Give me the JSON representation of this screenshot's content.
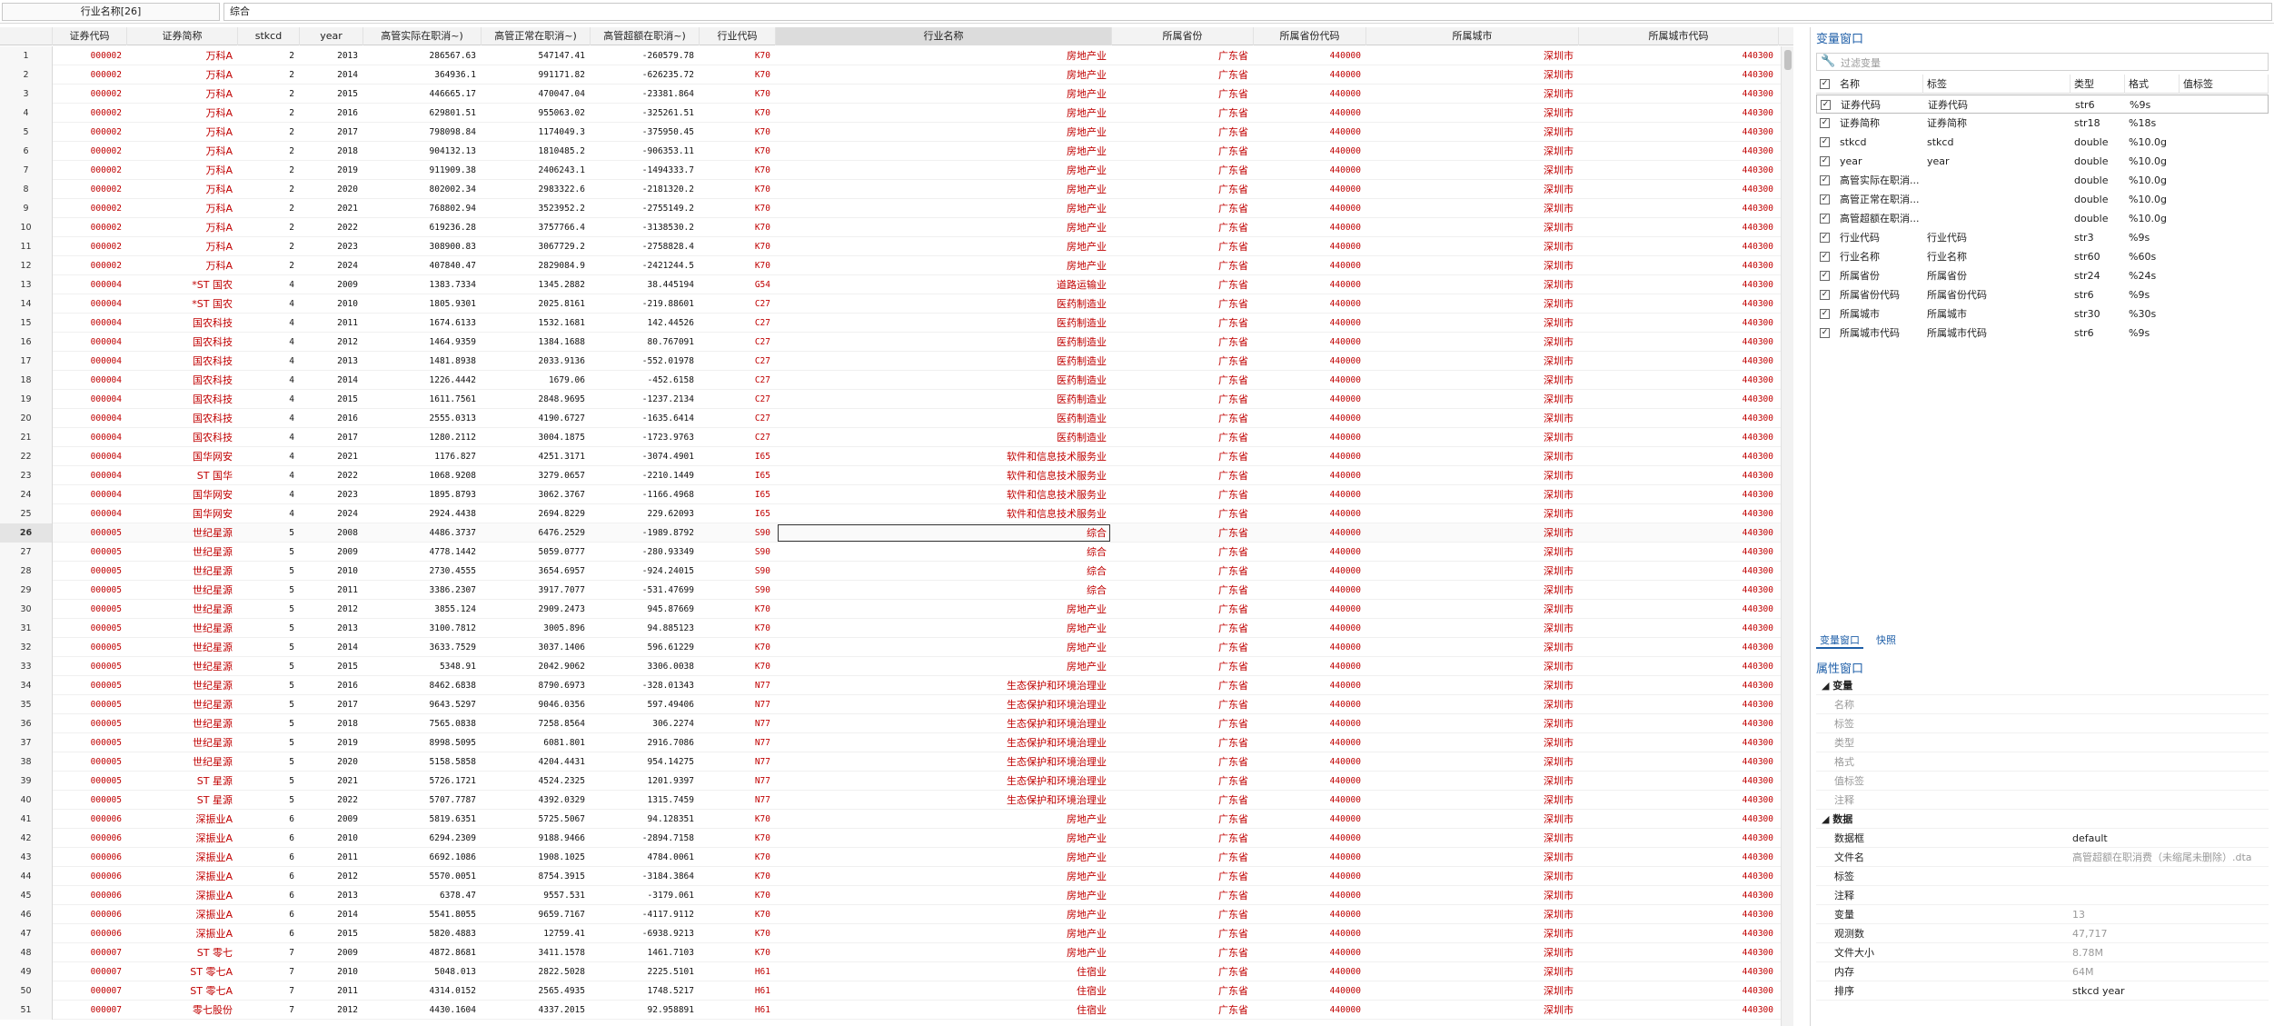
{
  "edit_bar": {
    "var_label": "行业名称[26]",
    "value": "综合"
  },
  "grid": {
    "columns": [
      "证券代码",
      "证券简称",
      "stkcd",
      "year",
      "高管实际在职消~)",
      "高管正常在职消~)",
      "高管超额在职消~)",
      "行业代码",
      "行业名称",
      "所属省份",
      "所属省份代码",
      "所属城市",
      "所属城市代码"
    ],
    "selected_column": "行业名称",
    "selected_row": 26,
    "rows": [
      [
        1,
        "000002",
        "万科A",
        "2",
        "2013",
        "286567.63",
        "547147.41",
        "-260579.78",
        "K70",
        "房地产业",
        "广东省",
        "440000",
        "深圳市",
        "440300"
      ],
      [
        2,
        "000002",
        "万科A",
        "2",
        "2014",
        "364936.1",
        "991171.82",
        "-626235.72",
        "K70",
        "房地产业",
        "广东省",
        "440000",
        "深圳市",
        "440300"
      ],
      [
        3,
        "000002",
        "万科A",
        "2",
        "2015",
        "446665.17",
        "470047.04",
        "-23381.864",
        "K70",
        "房地产业",
        "广东省",
        "440000",
        "深圳市",
        "440300"
      ],
      [
        4,
        "000002",
        "万科A",
        "2",
        "2016",
        "629801.51",
        "955063.02",
        "-325261.51",
        "K70",
        "房地产业",
        "广东省",
        "440000",
        "深圳市",
        "440300"
      ],
      [
        5,
        "000002",
        "万科A",
        "2",
        "2017",
        "798098.84",
        "1174049.3",
        "-375950.45",
        "K70",
        "房地产业",
        "广东省",
        "440000",
        "深圳市",
        "440300"
      ],
      [
        6,
        "000002",
        "万科A",
        "2",
        "2018",
        "904132.13",
        "1810485.2",
        "-906353.11",
        "K70",
        "房地产业",
        "广东省",
        "440000",
        "深圳市",
        "440300"
      ],
      [
        7,
        "000002",
        "万科A",
        "2",
        "2019",
        "911909.38",
        "2406243.1",
        "-1494333.7",
        "K70",
        "房地产业",
        "广东省",
        "440000",
        "深圳市",
        "440300"
      ],
      [
        8,
        "000002",
        "万科A",
        "2",
        "2020",
        "802002.34",
        "2983322.6",
        "-2181320.2",
        "K70",
        "房地产业",
        "广东省",
        "440000",
        "深圳市",
        "440300"
      ],
      [
        9,
        "000002",
        "万科A",
        "2",
        "2021",
        "768802.94",
        "3523952.2",
        "-2755149.2",
        "K70",
        "房地产业",
        "广东省",
        "440000",
        "深圳市",
        "440300"
      ],
      [
        10,
        "000002",
        "万科A",
        "2",
        "2022",
        "619236.28",
        "3757766.4",
        "-3138530.2",
        "K70",
        "房地产业",
        "广东省",
        "440000",
        "深圳市",
        "440300"
      ],
      [
        11,
        "000002",
        "万科A",
        "2",
        "2023",
        "308900.83",
        "3067729.2",
        "-2758828.4",
        "K70",
        "房地产业",
        "广东省",
        "440000",
        "深圳市",
        "440300"
      ],
      [
        12,
        "000002",
        "万科A",
        "2",
        "2024",
        "407840.47",
        "2829084.9",
        "-2421244.5",
        "K70",
        "房地产业",
        "广东省",
        "440000",
        "深圳市",
        "440300"
      ],
      [
        13,
        "000004",
        "*ST 国农",
        "4",
        "2009",
        "1383.7334",
        "1345.2882",
        "38.445194",
        "G54",
        "道路运输业",
        "广东省",
        "440000",
        "深圳市",
        "440300"
      ],
      [
        14,
        "000004",
        "*ST 国农",
        "4",
        "2010",
        "1805.9301",
        "2025.8161",
        "-219.88601",
        "C27",
        "医药制造业",
        "广东省",
        "440000",
        "深圳市",
        "440300"
      ],
      [
        15,
        "000004",
        "国农科技",
        "4",
        "2011",
        "1674.6133",
        "1532.1681",
        "142.44526",
        "C27",
        "医药制造业",
        "广东省",
        "440000",
        "深圳市",
        "440300"
      ],
      [
        16,
        "000004",
        "国农科技",
        "4",
        "2012",
        "1464.9359",
        "1384.1688",
        "80.767091",
        "C27",
        "医药制造业",
        "广东省",
        "440000",
        "深圳市",
        "440300"
      ],
      [
        17,
        "000004",
        "国农科技",
        "4",
        "2013",
        "1481.8938",
        "2033.9136",
        "-552.01978",
        "C27",
        "医药制造业",
        "广东省",
        "440000",
        "深圳市",
        "440300"
      ],
      [
        18,
        "000004",
        "国农科技",
        "4",
        "2014",
        "1226.4442",
        "1679.06",
        "-452.6158",
        "C27",
        "医药制造业",
        "广东省",
        "440000",
        "深圳市",
        "440300"
      ],
      [
        19,
        "000004",
        "国农科技",
        "4",
        "2015",
        "1611.7561",
        "2848.9695",
        "-1237.2134",
        "C27",
        "医药制造业",
        "广东省",
        "440000",
        "深圳市",
        "440300"
      ],
      [
        20,
        "000004",
        "国农科技",
        "4",
        "2016",
        "2555.0313",
        "4190.6727",
        "-1635.6414",
        "C27",
        "医药制造业",
        "广东省",
        "440000",
        "深圳市",
        "440300"
      ],
      [
        21,
        "000004",
        "国农科技",
        "4",
        "2017",
        "1280.2112",
        "3004.1875",
        "-1723.9763",
        "C27",
        "医药制造业",
        "广东省",
        "440000",
        "深圳市",
        "440300"
      ],
      [
        22,
        "000004",
        "国华网安",
        "4",
        "2021",
        "1176.827",
        "4251.3171",
        "-3074.4901",
        "I65",
        "软件和信息技术服务业",
        "广东省",
        "440000",
        "深圳市",
        "440300"
      ],
      [
        23,
        "000004",
        "ST 国华",
        "4",
        "2022",
        "1068.9208",
        "3279.0657",
        "-2210.1449",
        "I65",
        "软件和信息技术服务业",
        "广东省",
        "440000",
        "深圳市",
        "440300"
      ],
      [
        24,
        "000004",
        "国华网安",
        "4",
        "2023",
        "1895.8793",
        "3062.3767",
        "-1166.4968",
        "I65",
        "软件和信息技术服务业",
        "广东省",
        "440000",
        "深圳市",
        "440300"
      ],
      [
        25,
        "000004",
        "国华网安",
        "4",
        "2024",
        "2924.4438",
        "2694.8229",
        "229.62093",
        "I65",
        "软件和信息技术服务业",
        "广东省",
        "440000",
        "深圳市",
        "440300"
      ],
      [
        26,
        "000005",
        "世纪星源",
        "5",
        "2008",
        "4486.3737",
        "6476.2529",
        "-1989.8792",
        "S90",
        "综合",
        "广东省",
        "440000",
        "深圳市",
        "440300"
      ],
      [
        27,
        "000005",
        "世纪星源",
        "5",
        "2009",
        "4778.1442",
        "5059.0777",
        "-280.93349",
        "S90",
        "综合",
        "广东省",
        "440000",
        "深圳市",
        "440300"
      ],
      [
        28,
        "000005",
        "世纪星源",
        "5",
        "2010",
        "2730.4555",
        "3654.6957",
        "-924.24015",
        "S90",
        "综合",
        "广东省",
        "440000",
        "深圳市",
        "440300"
      ],
      [
        29,
        "000005",
        "世纪星源",
        "5",
        "2011",
        "3386.2307",
        "3917.7077",
        "-531.47699",
        "S90",
        "综合",
        "广东省",
        "440000",
        "深圳市",
        "440300"
      ],
      [
        30,
        "000005",
        "世纪星源",
        "5",
        "2012",
        "3855.124",
        "2909.2473",
        "945.87669",
        "K70",
        "房地产业",
        "广东省",
        "440000",
        "深圳市",
        "440300"
      ],
      [
        31,
        "000005",
        "世纪星源",
        "5",
        "2013",
        "3100.7812",
        "3005.896",
        "94.885123",
        "K70",
        "房地产业",
        "广东省",
        "440000",
        "深圳市",
        "440300"
      ],
      [
        32,
        "000005",
        "世纪星源",
        "5",
        "2014",
        "3633.7529",
        "3037.1406",
        "596.61229",
        "K70",
        "房地产业",
        "广东省",
        "440000",
        "深圳市",
        "440300"
      ],
      [
        33,
        "000005",
        "世纪星源",
        "5",
        "2015",
        "5348.91",
        "2042.9062",
        "3306.0038",
        "K70",
        "房地产业",
        "广东省",
        "440000",
        "深圳市",
        "440300"
      ],
      [
        34,
        "000005",
        "世纪星源",
        "5",
        "2016",
        "8462.6838",
        "8790.6973",
        "-328.01343",
        "N77",
        "生态保护和环境治理业",
        "广东省",
        "440000",
        "深圳市",
        "440300"
      ],
      [
        35,
        "000005",
        "世纪星源",
        "5",
        "2017",
        "9643.5297",
        "9046.0356",
        "597.49406",
        "N77",
        "生态保护和环境治理业",
        "广东省",
        "440000",
        "深圳市",
        "440300"
      ],
      [
        36,
        "000005",
        "世纪星源",
        "5",
        "2018",
        "7565.0838",
        "7258.8564",
        "306.2274",
        "N77",
        "生态保护和环境治理业",
        "广东省",
        "440000",
        "深圳市",
        "440300"
      ],
      [
        37,
        "000005",
        "世纪星源",
        "5",
        "2019",
        "8998.5095",
        "6081.801",
        "2916.7086",
        "N77",
        "生态保护和环境治理业",
        "广东省",
        "440000",
        "深圳市",
        "440300"
      ],
      [
        38,
        "000005",
        "世纪星源",
        "5",
        "2020",
        "5158.5858",
        "4204.4431",
        "954.14275",
        "N77",
        "生态保护和环境治理业",
        "广东省",
        "440000",
        "深圳市",
        "440300"
      ],
      [
        39,
        "000005",
        "ST 星源",
        "5",
        "2021",
        "5726.1721",
        "4524.2325",
        "1201.9397",
        "N77",
        "生态保护和环境治理业",
        "广东省",
        "440000",
        "深圳市",
        "440300"
      ],
      [
        40,
        "000005",
        "ST 星源",
        "5",
        "2022",
        "5707.7787",
        "4392.0329",
        "1315.7459",
        "N77",
        "生态保护和环境治理业",
        "广东省",
        "440000",
        "深圳市",
        "440300"
      ],
      [
        41,
        "000006",
        "深振业A",
        "6",
        "2009",
        "5819.6351",
        "5725.5067",
        "94.128351",
        "K70",
        "房地产业",
        "广东省",
        "440000",
        "深圳市",
        "440300"
      ],
      [
        42,
        "000006",
        "深振业A",
        "6",
        "2010",
        "6294.2309",
        "9188.9466",
        "-2894.7158",
        "K70",
        "房地产业",
        "广东省",
        "440000",
        "深圳市",
        "440300"
      ],
      [
        43,
        "000006",
        "深振业A",
        "6",
        "2011",
        "6692.1086",
        "1908.1025",
        "4784.0061",
        "K70",
        "房地产业",
        "广东省",
        "440000",
        "深圳市",
        "440300"
      ],
      [
        44,
        "000006",
        "深振业A",
        "6",
        "2012",
        "5570.0051",
        "8754.3915",
        "-3184.3864",
        "K70",
        "房地产业",
        "广东省",
        "440000",
        "深圳市",
        "440300"
      ],
      [
        45,
        "000006",
        "深振业A",
        "6",
        "2013",
        "6378.47",
        "9557.531",
        "-3179.061",
        "K70",
        "房地产业",
        "广东省",
        "440000",
        "深圳市",
        "440300"
      ],
      [
        46,
        "000006",
        "深振业A",
        "6",
        "2014",
        "5541.8055",
        "9659.7167",
        "-4117.9112",
        "K70",
        "房地产业",
        "广东省",
        "440000",
        "深圳市",
        "440300"
      ],
      [
        47,
        "000006",
        "深振业A",
        "6",
        "2015",
        "5820.4883",
        "12759.41",
        "-6938.9213",
        "K70",
        "房地产业",
        "广东省",
        "440000",
        "深圳市",
        "440300"
      ],
      [
        48,
        "000007",
        "ST 零七",
        "7",
        "2009",
        "4872.8681",
        "3411.1578",
        "1461.7103",
        "K70",
        "房地产业",
        "广东省",
        "440000",
        "深圳市",
        "440300"
      ],
      [
        49,
        "000007",
        "ST 零七A",
        "7",
        "2010",
        "5048.013",
        "2822.5028",
        "2225.5101",
        "H61",
        "住宿业",
        "广东省",
        "440000",
        "深圳市",
        "440300"
      ],
      [
        50,
        "000007",
        "ST 零七A",
        "7",
        "2011",
        "4314.0152",
        "2565.4935",
        "1748.5217",
        "H61",
        "住宿业",
        "广东省",
        "440000",
        "深圳市",
        "440300"
      ],
      [
        51,
        "000007",
        "零七股份",
        "7",
        "2012",
        "4430.1604",
        "4337.2015",
        "92.958891",
        "H61",
        "住宿业",
        "广东省",
        "440000",
        "深圳市",
        "440300"
      ]
    ]
  },
  "variables_panel": {
    "title": "变量窗口",
    "filter_placeholder": "过滤变量",
    "headers": [
      "名称",
      "标签",
      "类型",
      "格式",
      "值标签"
    ],
    "vars": [
      [
        "证券代码",
        "证券代码",
        "str6",
        "%9s",
        ""
      ],
      [
        "证券简称",
        "证券简称",
        "str18",
        "%18s",
        ""
      ],
      [
        "stkcd",
        "stkcd",
        "double",
        "%10.0g",
        ""
      ],
      [
        "year",
        "year",
        "double",
        "%10.0g",
        ""
      ],
      [
        "高管实际在职消...",
        "",
        "double",
        "%10.0g",
        ""
      ],
      [
        "高管正常在职消...",
        "",
        "double",
        "%10.0g",
        ""
      ],
      [
        "高管超额在职消...",
        "",
        "double",
        "%10.0g",
        ""
      ],
      [
        "行业代码",
        "行业代码",
        "str3",
        "%9s",
        ""
      ],
      [
        "行业名称",
        "行业名称",
        "str60",
        "%60s",
        ""
      ],
      [
        "所属省份",
        "所属省份",
        "str24",
        "%24s",
        ""
      ],
      [
        "所属省份代码",
        "所属省份代码",
        "str6",
        "%9s",
        ""
      ],
      [
        "所属城市",
        "所属城市",
        "str30",
        "%30s",
        ""
      ],
      [
        "所属城市代码",
        "所属城市代码",
        "str6",
        "%9s",
        ""
      ]
    ],
    "tabs": [
      "变量窗口",
      "快照"
    ]
  },
  "properties_panel": {
    "title": "属性窗口",
    "variable_section": "变量",
    "variable_fields": [
      "名称",
      "标签",
      "类型",
      "格式",
      "值标签",
      "注释"
    ],
    "data_section": "数据",
    "data_fields": [
      [
        "数据框",
        "default"
      ],
      [
        "文件名",
        "高管超额在职消费（未缩尾未删除）.dta"
      ],
      [
        "标签",
        ""
      ],
      [
        "注释",
        ""
      ],
      [
        "变量",
        "13"
      ],
      [
        "观测数",
        "47,717"
      ],
      [
        "文件大小",
        "8.78M"
      ],
      [
        "内存",
        "64M"
      ],
      [
        "排序",
        "stkcd year"
      ]
    ]
  },
  "colors": {
    "string_text": "#c00000",
    "panel_title": "#1f5fa8"
  }
}
